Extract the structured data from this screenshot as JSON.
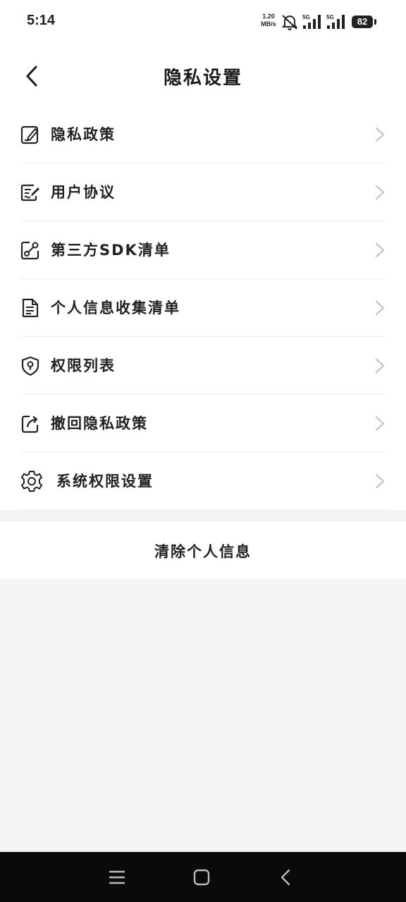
{
  "status_bar": {
    "time": "5:14",
    "net_speed_value": "1.20",
    "net_speed_unit": "MB/s",
    "sim1_label": "5G",
    "sim2_label": "5G",
    "battery": "82"
  },
  "header": {
    "title": "隐私设置",
    "back_icon": "chevron-left-icon"
  },
  "menu": {
    "items": [
      {
        "label": "隐私政策",
        "icon": "document-edit-icon"
      },
      {
        "label": "用户协议",
        "icon": "agreement-pen-icon"
      },
      {
        "label": "第三方SDK清单",
        "icon": "share-link-icon"
      },
      {
        "label": "个人信息收集清单",
        "icon": "file-list-icon"
      },
      {
        "label": "权限列表",
        "icon": "shield-location-icon"
      },
      {
        "label": "撤回隐私政策",
        "icon": "revoke-arrow-icon"
      },
      {
        "label": "系统权限设置",
        "icon": "gear-icon"
      }
    ]
  },
  "clear_button": {
    "label": "清除个人信息"
  },
  "nav_bar": {
    "icons": [
      "menu-icon",
      "home-icon",
      "back-icon"
    ]
  },
  "colors": {
    "background": "#f4f4f4",
    "card": "#ffffff",
    "text": "#222222",
    "chevron": "#c8c8c8",
    "nav_bar": "#0a0a0a"
  }
}
